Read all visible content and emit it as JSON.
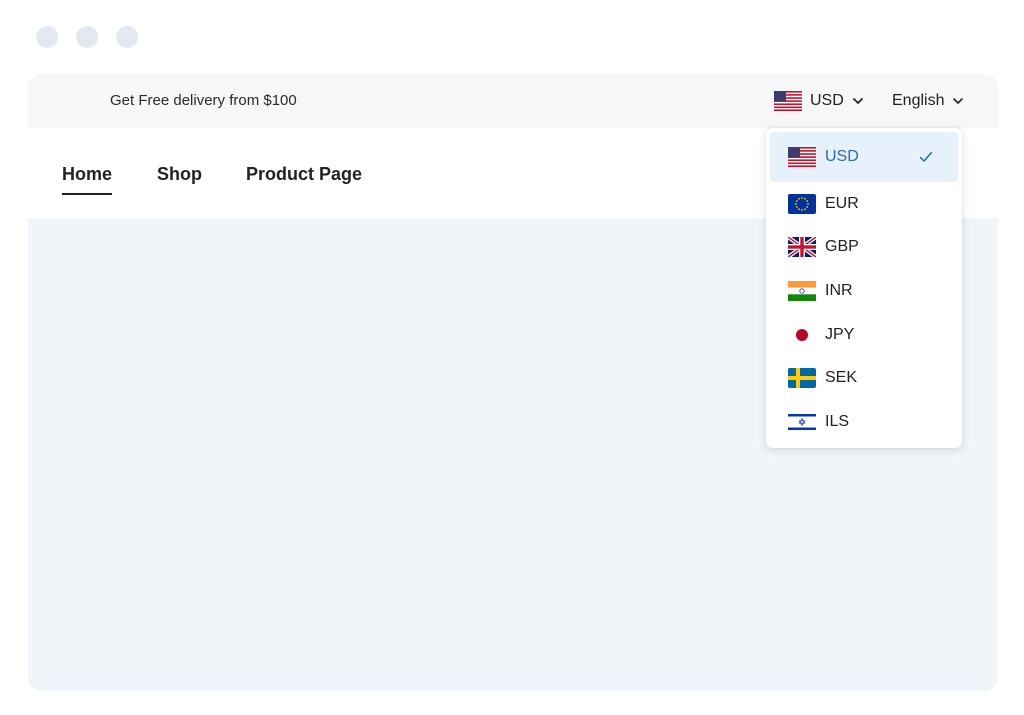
{
  "topbar": {
    "promo_text": "Get Free delivery from $100",
    "currency_label": "USD",
    "language_label": "English"
  },
  "nav": {
    "items": [
      {
        "label": "Home",
        "active": true
      },
      {
        "label": "Shop",
        "active": false
      },
      {
        "label": "Product Page",
        "active": false
      }
    ]
  },
  "currency_menu": {
    "selected": "USD",
    "options": [
      {
        "code": "USD",
        "flag": "us-flag-icon"
      },
      {
        "code": "EUR",
        "flag": "eu-flag-icon"
      },
      {
        "code": "GBP",
        "flag": "uk-flag-icon"
      },
      {
        "code": "INR",
        "flag": "india-flag-icon"
      },
      {
        "code": "JPY",
        "flag": "japan-flag-icon"
      },
      {
        "code": "SEK",
        "flag": "sweden-flag-icon"
      },
      {
        "code": "ILS",
        "flag": "israel-flag-icon"
      }
    ]
  },
  "colors": {
    "selected_bg": "#e6f1fb",
    "selected_text": "#2b6da8",
    "content_bg": "#f0f5fa",
    "topbar_bg": "#f7f7f8"
  }
}
